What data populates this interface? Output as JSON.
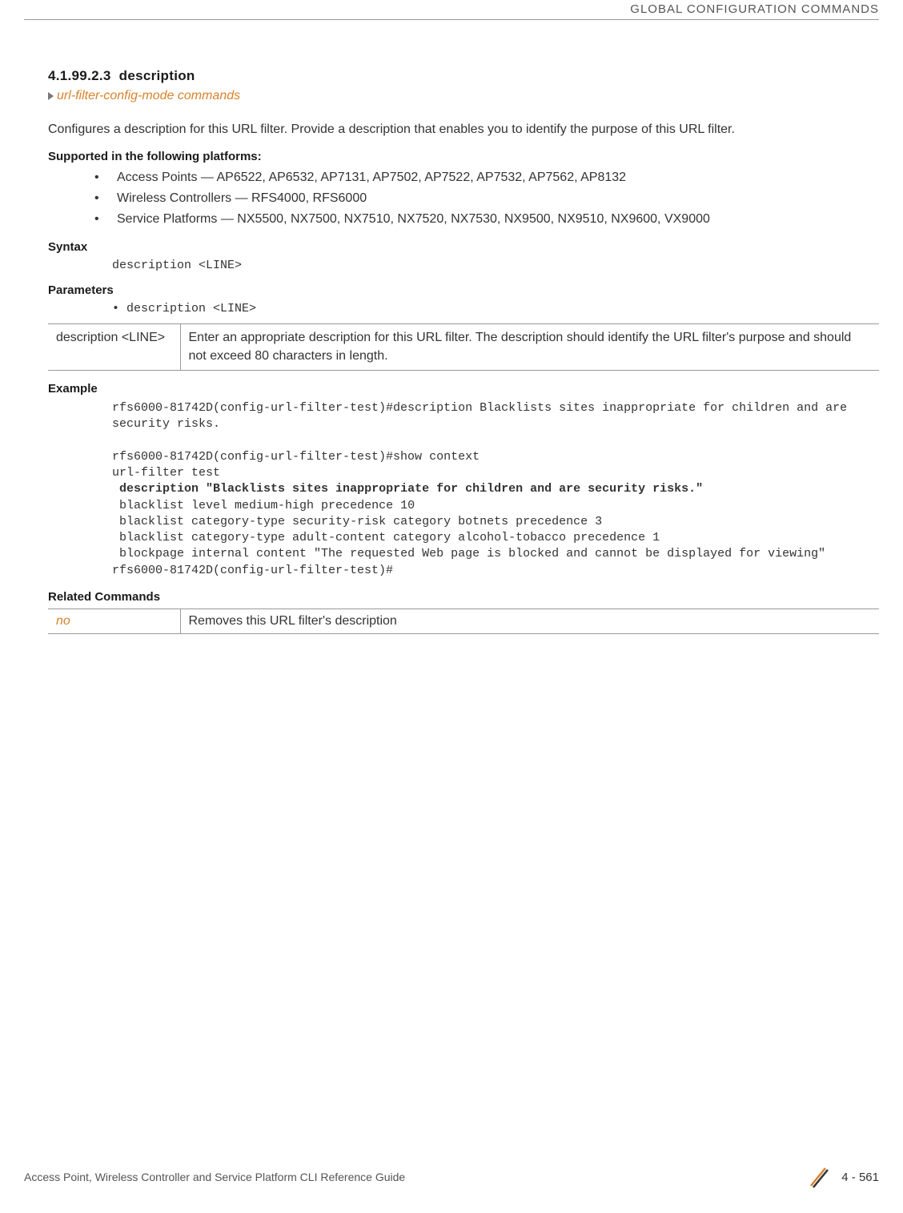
{
  "header": {
    "chapter": "GLOBAL CONFIGURATION COMMANDS"
  },
  "section": {
    "number": "4.1.99.2.3",
    "title": "description",
    "breadcrumb": "url-filter-config-mode commands"
  },
  "intro": "Configures a description for this URL filter. Provide a description that enables you to identify the purpose of this URL filter.",
  "platforms": {
    "heading": "Supported in the following platforms:",
    "items": [
      "Access Points — AP6522, AP6532, AP7131, AP7502, AP7522, AP7532, AP7562, AP8132",
      "Wireless Controllers — RFS4000, RFS6000",
      "Service Platforms — NX5500, NX7500, NX7510, NX7520, NX7530, NX9500, NX9510, NX9600, VX9000"
    ]
  },
  "syntax": {
    "heading": "Syntax",
    "line": "description <LINE>"
  },
  "parameters": {
    "heading": "Parameters",
    "bullet": "• description <LINE>",
    "table": {
      "param": "description <LINE>",
      "desc": "Enter an appropriate description for this URL filter. The description should identify the URL filter's purpose and should not exceed 80 characters in length."
    }
  },
  "example": {
    "heading": "Example",
    "line1": "rfs6000-81742D(config-url-filter-test)#description Blacklists sites inappropriate for children and are security risks.",
    "line2": "rfs6000-81742D(config-url-filter-test)#show context",
    "line3": "url-filter test",
    "lineBold": " description \"Blacklists sites inappropriate for children and are security risks.\"",
    "line4": " blacklist level medium-high precedence 10",
    "line5": " blacklist category-type security-risk category botnets precedence 3",
    "line6": " blacklist category-type adult-content category alcohol-tobacco precedence 1",
    "line7": " blockpage internal content \"The requested Web page is blocked and cannot be displayed for viewing\"",
    "line8": "rfs6000-81742D(config-url-filter-test)#"
  },
  "related": {
    "heading": "Related Commands",
    "cmd": "no",
    "desc": "Removes this URL filter's description"
  },
  "footer": {
    "text": "Access Point, Wireless Controller and Service Platform CLI Reference Guide",
    "page": "4 - 561"
  }
}
